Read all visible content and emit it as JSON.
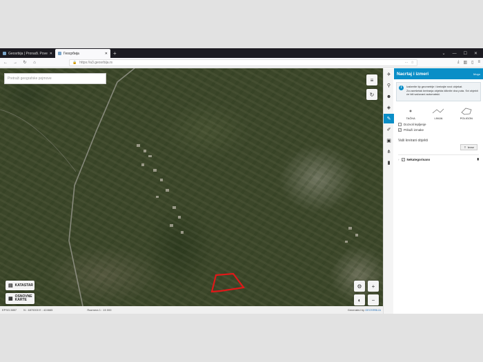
{
  "browser": {
    "tabs": [
      {
        "title": "Geosrbija | Pronađi. Povedi. Pr...",
        "active": false
      },
      {
        "title": "Геосрбија",
        "active": true
      }
    ],
    "url": "https://a3.geosrbija.rs"
  },
  "map": {
    "search_placeholder": "Pretraži geografske pojmove",
    "layer_buttons": {
      "katastar": "KATASTAR",
      "osnovne_karte": "OSNOVNE KARTE"
    },
    "status": {
      "crs": "EPSG:3857",
      "coords": "N : 4870000  E : 424665",
      "scale": "Razmera 1 : 15 000",
      "credit_prefix": "Generated by",
      "credit_link": "GEOSRBIJA"
    },
    "drawn_polygon_color": "#e01818"
  },
  "rail": {
    "icons": [
      "pin-icon",
      "location-icon",
      "person-icon",
      "layers-icon",
      "pencil-icon",
      "brush-icon",
      "briefcase-icon",
      "share-icon",
      "trash-icon"
    ],
    "active_index": 4
  },
  "panel": {
    "title": "Nacrtaj i izmeri",
    "more": "Mogo",
    "info_line1": "Izaberite tip geometrije i kreirajte novi objekat.",
    "info_line2": "Za završetak kreiranja objekta kliknite dva puta. Svi objekti će biti sačuvani automatski.",
    "geometry_types": [
      "TAČKA",
      "LINIJA",
      "POLIGON"
    ],
    "checkboxes": [
      {
        "label": "Dozvoli lepljenje",
        "checked": false
      },
      {
        "label": "Prikaži izmake",
        "checked": true
      }
    ],
    "section_title": "Vaši kreirani objekti",
    "export_label": "Izvoz",
    "layer_name": "Nekategorisano",
    "accent_color": "#0a8ec7"
  }
}
